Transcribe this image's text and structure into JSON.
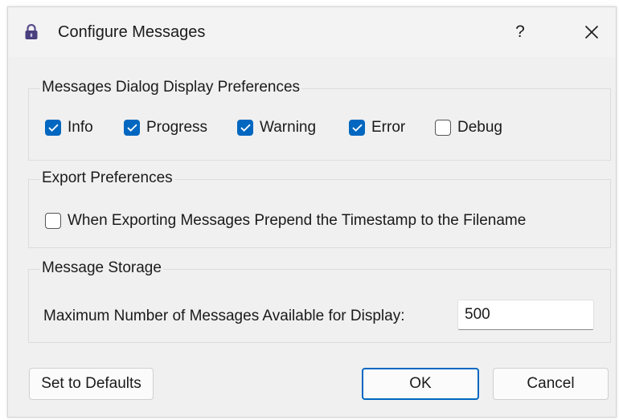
{
  "window": {
    "title": "Configure Messages",
    "help_label": "?",
    "icons": {
      "title": "lock-icon",
      "close": "close-icon"
    }
  },
  "display_prefs": {
    "title": "Messages Dialog Display Preferences",
    "options": [
      {
        "label": "Info",
        "checked": true
      },
      {
        "label": "Progress",
        "checked": true
      },
      {
        "label": "Warning",
        "checked": true
      },
      {
        "label": "Error",
        "checked": true
      },
      {
        "label": "Debug",
        "checked": false
      }
    ]
  },
  "export_prefs": {
    "title": "Export Preferences",
    "prepend_label": "When Exporting Messages Prepend the Timestamp to the Filename",
    "prepend_checked": false
  },
  "storage": {
    "title": "Message Storage",
    "max_label": "Maximum Number of Messages Available for Display:",
    "max_value": "500"
  },
  "buttons": {
    "defaults": "Set to Defaults",
    "ok": "OK",
    "cancel": "Cancel"
  },
  "colors": {
    "accent": "#0067c0",
    "dialog_bg": "#f0f0f0"
  }
}
